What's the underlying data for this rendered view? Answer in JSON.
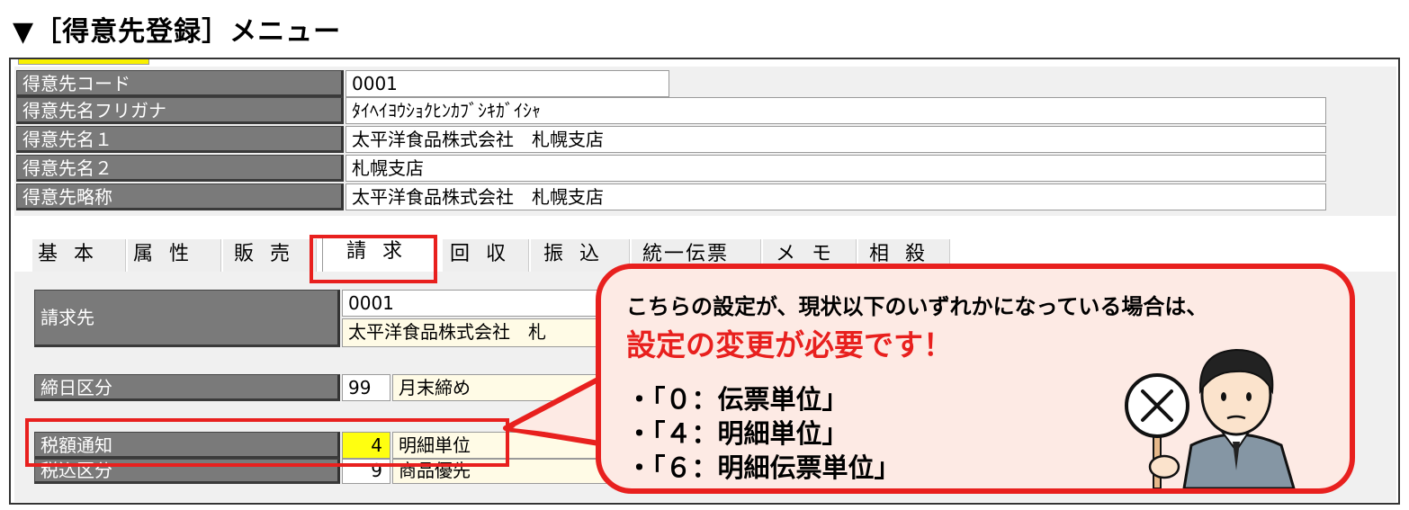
{
  "heading": "▼［得意先登録］メニュー",
  "customer": {
    "code_label": "得意先コード",
    "code_value": "0001",
    "kana_label": "得意先名フリガナ",
    "kana_value": "ﾀｲﾍｲﾖｳｼｮｸﾋﾝｶﾌﾞｼｷｶﾞｲｼｬ",
    "name1_label": "得意先名１",
    "name1_value": "太平洋食品株式会社　札幌支店",
    "name2_label": "得意先名２",
    "name2_value": "札幌支店",
    "short_label": "得意先略称",
    "short_value": "太平洋食品株式会社　札幌支店"
  },
  "tabs": [
    "基本",
    "属性",
    "販売",
    "請求",
    "回収",
    "振込",
    "統一伝票",
    "メモ",
    "相殺"
  ],
  "active_tab": "請求",
  "billing": {
    "billto_label": "請求先",
    "billto_code": "0001",
    "billto_name": "太平洋食品株式会社　札",
    "closing_label": "締日区分",
    "closing_code": "99",
    "closing_name": "月末締め",
    "taxnotice_label": "税額通知",
    "taxnotice_code": "4",
    "taxnotice_name": "明細単位",
    "taxincl_label": "税込区分",
    "taxincl_code": "9",
    "taxincl_name": "商品優先"
  },
  "callout": {
    "line1": "こちらの設定が、現状以下のいずれかになっている場合は、",
    "line2": "設定の変更が必要です！",
    "items": [
      "・「０：伝票単位」",
      "・「４：明細単位」",
      "・「６：明細伝票単位」"
    ],
    "accent_color": "#e8201e",
    "fill_color": "#fdeae4"
  },
  "icons": {
    "character": "person-with-x-sign-icon",
    "x_mark": "close-icon"
  }
}
